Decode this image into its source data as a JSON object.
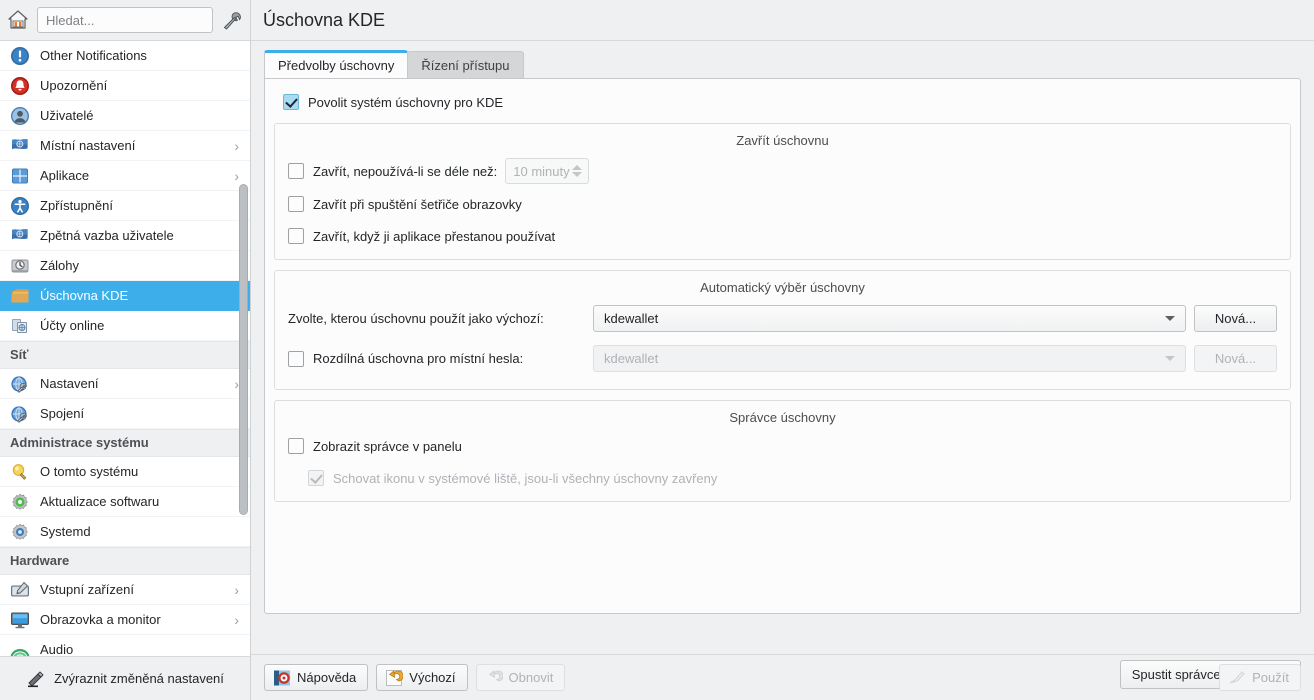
{
  "sidebar": {
    "home_icon": "home-icon",
    "tools_icon": "tools-icon",
    "search": {
      "placeholder": "Hledat...",
      "value": ""
    },
    "highlight_button": {
      "label": "Zvýraznit změněná nastavení",
      "icon": "pen-icon"
    },
    "items": [
      {
        "label": "Other Notifications",
        "icon": "notification-icon",
        "type": "item",
        "arrow": false,
        "selected": false
      },
      {
        "label": "Upozornění",
        "icon": "bell-icon",
        "type": "item",
        "arrow": false,
        "selected": false
      },
      {
        "label": "Uživatelé",
        "icon": "user-icon",
        "type": "item",
        "arrow": false,
        "selected": false
      },
      {
        "label": "Místní nastavení",
        "icon": "flag-icon",
        "type": "item",
        "arrow": true,
        "selected": false
      },
      {
        "label": "Aplikace",
        "icon": "apps-icon",
        "type": "item",
        "arrow": true,
        "selected": false
      },
      {
        "label": "Zpřístupnění",
        "icon": "accessibility-icon",
        "type": "item",
        "arrow": false,
        "selected": false
      },
      {
        "label": "Zpětná vazba uživatele",
        "icon": "flag-icon",
        "type": "item",
        "arrow": false,
        "selected": false
      },
      {
        "label": "Zálohy",
        "icon": "backup-disk-icon",
        "type": "item",
        "arrow": false,
        "selected": false
      },
      {
        "label": "Úschovna KDE",
        "icon": "wallet-icon",
        "type": "item",
        "arrow": false,
        "selected": true
      },
      {
        "label": "Účty online",
        "icon": "online-accounts-icon",
        "type": "item",
        "arrow": false,
        "selected": false
      },
      {
        "label": "Síť",
        "type": "category"
      },
      {
        "label": "Nastavení",
        "icon": "network-settings-icon",
        "type": "item",
        "arrow": true,
        "selected": false
      },
      {
        "label": "Spojení",
        "icon": "network-connections-icon",
        "type": "item",
        "arrow": false,
        "selected": false
      },
      {
        "label": "Administrace systému",
        "type": "category"
      },
      {
        "label": "O tomto systému",
        "icon": "lightbulb-icon",
        "type": "item",
        "arrow": false,
        "selected": false
      },
      {
        "label": "Aktualizace softwaru",
        "icon": "software-update-icon",
        "type": "item",
        "arrow": false,
        "selected": false
      },
      {
        "label": "Systemd",
        "icon": "gear-icon",
        "type": "item",
        "arrow": false,
        "selected": false
      },
      {
        "label": "Hardware",
        "type": "category"
      },
      {
        "label": "Vstupní zařízení",
        "icon": "input-devices-icon",
        "type": "item",
        "arrow": true,
        "selected": false
      },
      {
        "label": "Obrazovka a monitor",
        "icon": "display-icon",
        "type": "item",
        "arrow": true,
        "selected": false
      },
      {
        "label": "Audio",
        "icon": "audio-icon",
        "type": "item",
        "arrow": false,
        "selected": false
      }
    ]
  },
  "main": {
    "title": "Úschovna KDE",
    "tabs": [
      {
        "label": "Předvolby úschovny",
        "active": true
      },
      {
        "label": "Řízení přístupu",
        "active": false
      }
    ],
    "enable_checkbox": {
      "label": "Povolit systém úschovny pro KDE",
      "checked": true
    },
    "close_group": {
      "title": "Zavřít úschovnu",
      "idle": {
        "label": "Zavřít, nepoužívá-li se déle než:",
        "checked": false
      },
      "idle_spin": {
        "value": "10 minuty",
        "enabled": false
      },
      "screensaver": {
        "label": "Zavřít při spuštění šetřiče obrazovky",
        "checked": false
      },
      "no_use": {
        "label": "Zavřít, když ji aplikace přestanou používat",
        "checked": false
      }
    },
    "auto_group": {
      "title": "Automatický výběr úschovny",
      "default_label": "Zvolte, kterou úschovnu použít jako výchozí:",
      "default_value": "kdewallet",
      "default_new_button": "Nová...",
      "local": {
        "label": "Rozdílná úschovna pro místní hesla:",
        "checked": false
      },
      "local_value": "kdewallet",
      "local_new_button": "Nová..."
    },
    "manager_group": {
      "title": "Správce úschovny",
      "show_manager": {
        "label": "Zobrazit správce v panelu",
        "checked": false
      },
      "hide_icon": {
        "label": "Schovat ikonu v systémové liště, jsou-li všechny úschovny zavřeny",
        "checked": true,
        "enabled": false
      }
    },
    "launch_manager_button": "Spustit správce úschovny...",
    "footer": {
      "help": {
        "label": "Nápověda",
        "icon": "help-icon"
      },
      "defaults": {
        "label": "Výchozí",
        "icon": "defaults-icon"
      },
      "reset": {
        "label": "Obnovit",
        "icon": "reset-icon",
        "enabled": false
      },
      "apply": {
        "label": "Použít",
        "icon": "apply-icon",
        "enabled": false
      }
    }
  },
  "colors": {
    "accent": "#3daee9",
    "window": "#eff0f1",
    "view": "#fcfcfc",
    "text": "#232629",
    "disabled_text": "#aeb2b6"
  }
}
